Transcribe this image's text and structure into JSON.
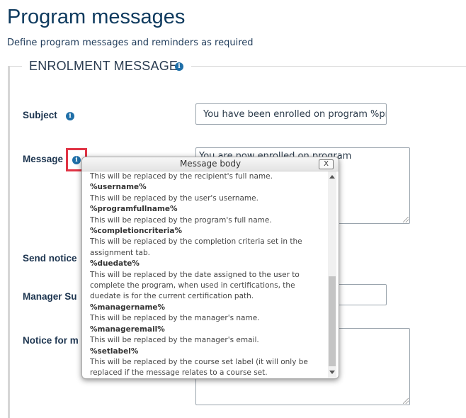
{
  "page": {
    "title": "Program messages",
    "subtitle": "Define program messages and reminders as required"
  },
  "section": {
    "legend": "ENROLMENT MESSAGE"
  },
  "form": {
    "subject_label": "Subject",
    "subject_value": "You have been enrolled on program %progra",
    "message_label": "Message",
    "message_value": "You are now enrolled on program",
    "send_notice_label": "Send notice",
    "manager_subject_label": "Manager Su",
    "notice_for_manager_label": "Notice for m"
  },
  "icons": {
    "info": "i"
  },
  "popup": {
    "title": "Message body",
    "close_label": "X",
    "items": [
      {
        "token": "",
        "desc": "This will be replaced by the recipient's full name."
      },
      {
        "token": "%username%",
        "desc": "This will be replaced by the user's username."
      },
      {
        "token": "%programfullname%",
        "desc": "This will be replaced by the program's full name."
      },
      {
        "token": "%completioncriteria%",
        "desc": "This will be replaced by the completion criteria set in the assignment tab."
      },
      {
        "token": "%duedate%",
        "desc": "This will be replaced by the date assigned to the user to complete the program, when used in certifications, the duedate is for the current certification path."
      },
      {
        "token": "%managername%",
        "desc": "This will be replaced by the manager's name."
      },
      {
        "token": "%manageremail%",
        "desc": "This will be replaced by the manager's email."
      },
      {
        "token": "%setlabel%",
        "desc": "This will be replaced by the course set label (it will only be replaced if the message relates to a course set."
      }
    ]
  },
  "colors": {
    "accent": "#1f6fa8",
    "heading": "#0e3a5e",
    "highlight": "#e03445"
  }
}
